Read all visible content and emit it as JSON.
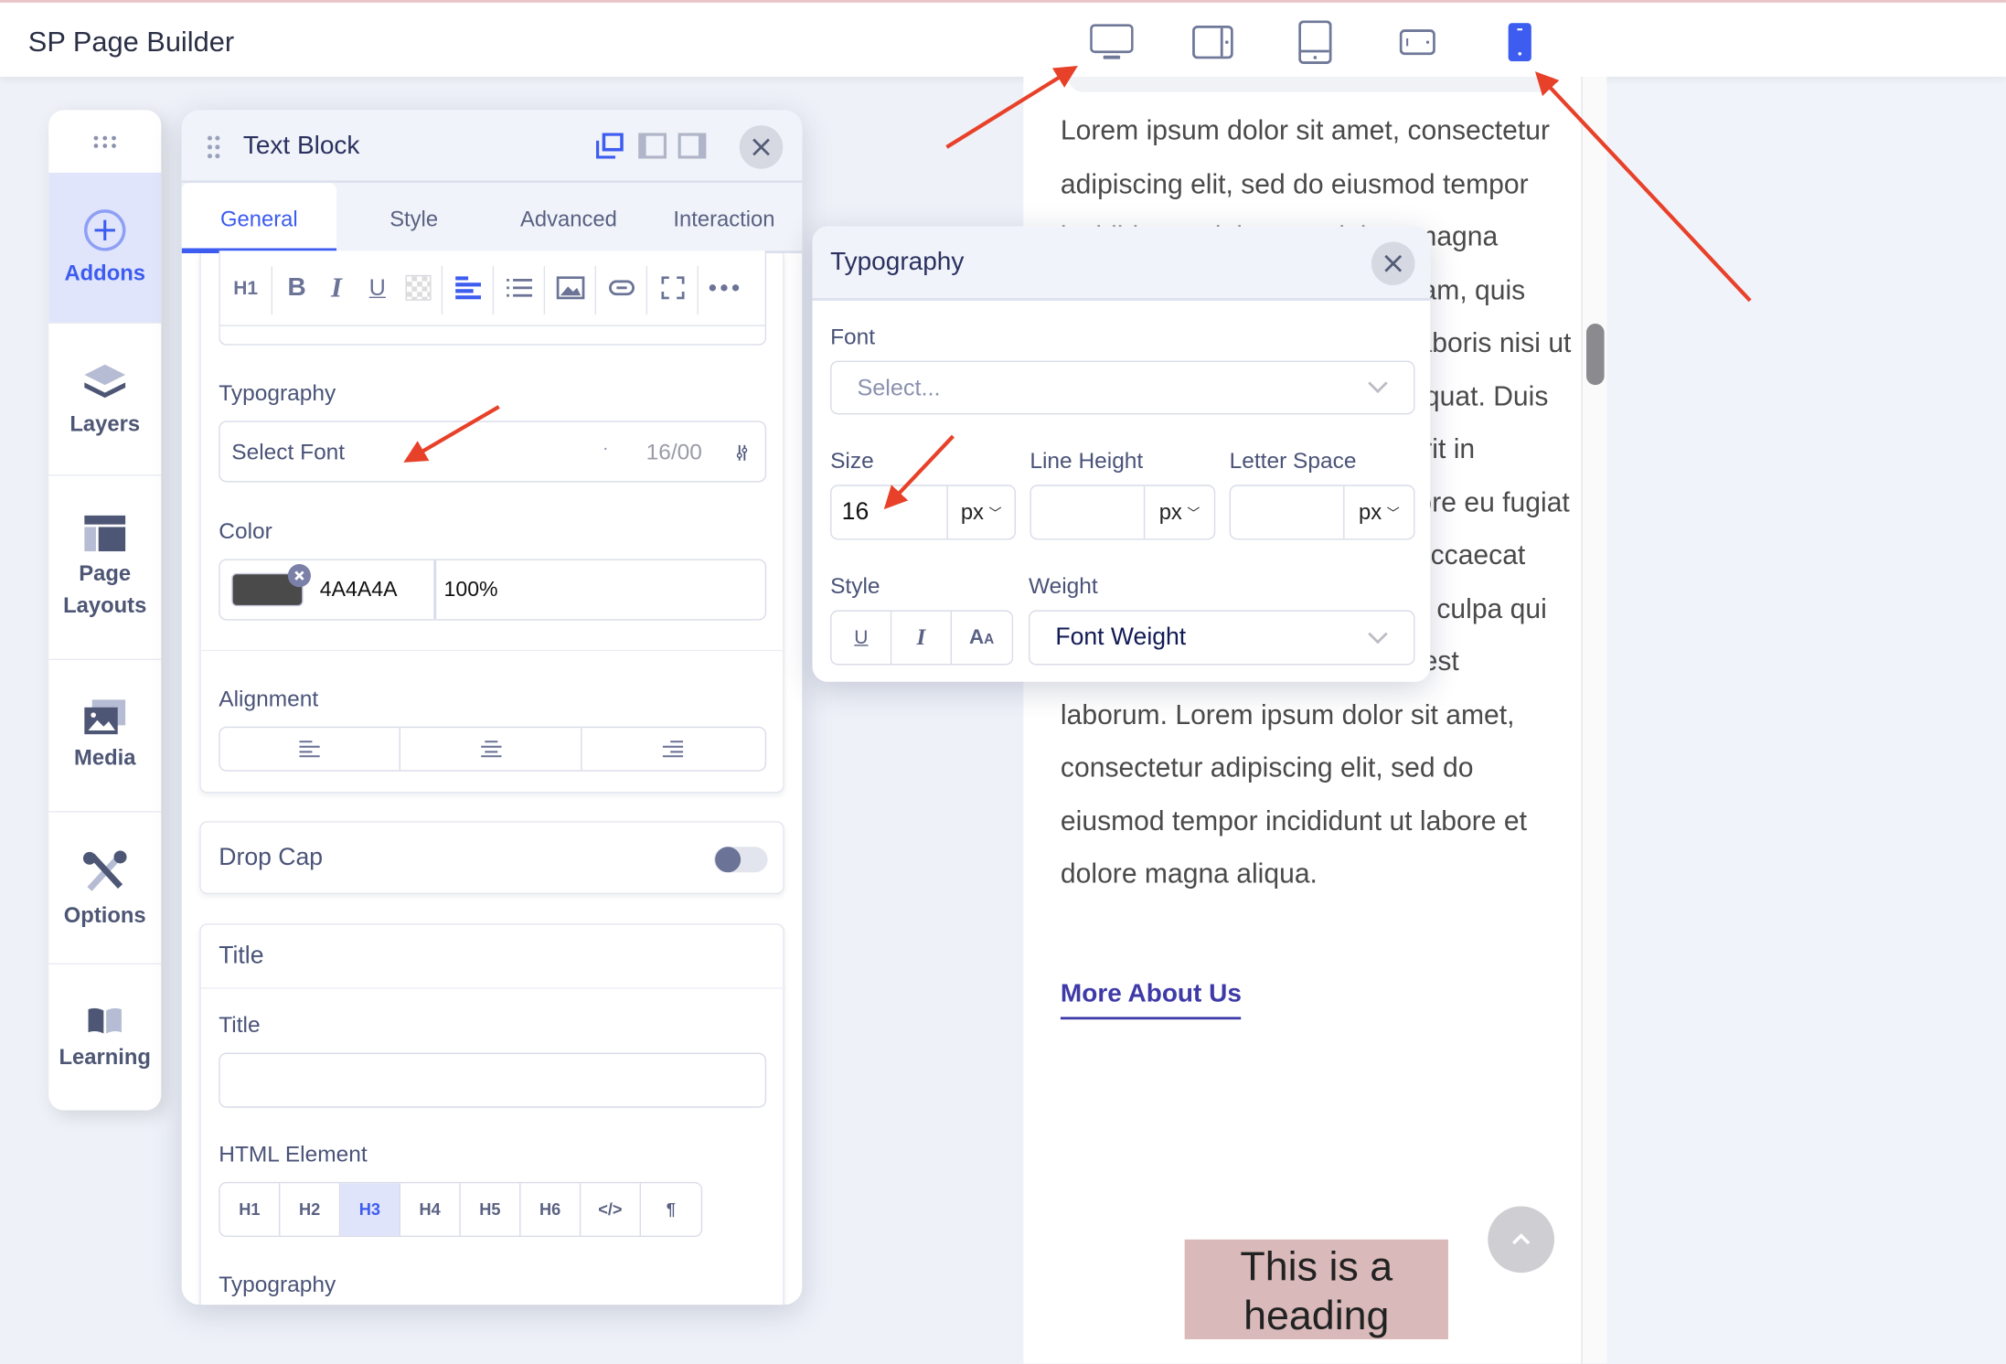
{
  "app": {
    "title": "SP Page Builder"
  },
  "devices": [
    {
      "name": "desktop",
      "active": false
    },
    {
      "name": "tablet-landscape",
      "active": false
    },
    {
      "name": "tablet-portrait",
      "active": false
    },
    {
      "name": "mobile-landscape",
      "active": false
    },
    {
      "name": "mobile-portrait",
      "active": true
    }
  ],
  "colors": {
    "accent": "#3d5cf0",
    "annotation_arrow": "#e8412a",
    "heading_bg": "#d9b9b9",
    "link": "#3e3aa8"
  },
  "sidebar": {
    "items": [
      {
        "label": "Addons",
        "icon": "plus-circle-icon",
        "active": true
      },
      {
        "label": "Layers",
        "icon": "layers-icon"
      },
      {
        "label": "Page Layouts",
        "icon": "layout-icon"
      },
      {
        "label": "Media",
        "icon": "media-icon"
      },
      {
        "label": "Options",
        "icon": "tools-icon"
      },
      {
        "label": "Learning",
        "icon": "book-icon"
      }
    ]
  },
  "panel": {
    "title": "Text Block",
    "tabs": [
      "General",
      "Style",
      "Advanced",
      "Interaction"
    ],
    "toolbar": {
      "heading": "H1"
    },
    "typography_label": "Typography",
    "font_select": "Select Font",
    "font_size_summary": "16/00",
    "color_label": "Color",
    "color_hex": "4A4A4A",
    "color_value": "#4a4a4a",
    "color_opacity": "100%",
    "alignment_label": "Alignment",
    "drop_cap_label": "Drop Cap",
    "drop_cap_on": false,
    "title_section": "Title",
    "title_label": "Title",
    "title_value": "",
    "html_element_label": "HTML Element",
    "html_elements": [
      "H1",
      "H2",
      "H3",
      "H4",
      "H5",
      "H6",
      "</>",
      "¶"
    ],
    "html_element_selected": "H3",
    "typography2_label": "Typography"
  },
  "typography_popup": {
    "title": "Typography",
    "font_label": "Font",
    "font_placeholder": "Select...",
    "size_label": "Size",
    "size_value": "16",
    "size_unit": "px",
    "line_height_label": "Line Height",
    "line_height_value": "",
    "line_height_unit": "px",
    "letter_space_label": "Letter Space",
    "letter_space_value": "",
    "letter_space_unit": "px",
    "style_label": "Style",
    "weight_label": "Weight",
    "weight_value": "Font Weight"
  },
  "preview": {
    "body": "Lorem ipsum dolor sit amet, consectetur adipiscing elit, sed do eiusmod tempor incididunt ut labore et dolore magna aliqua. Ut enim ad minim veniam, quis nostrud exercitation ullamco laboris nisi ut aliquip ex ea commodo consequat. Duis aute irure dolor in reprehenderit in voluptate velit esse cillum dolore eu fugiat nulla pariatur. Excepteur sint occaecat cupidatat non proident, sunt in culpa qui officia deserunt mollit anim id est laborum. Lorem ipsum dolor sit amet, consectetur adipiscing elit, sed do eiusmod tempor incididunt ut labore et dolore magna aliqua.",
    "link": "More About Us",
    "heading": "This is a heading"
  }
}
